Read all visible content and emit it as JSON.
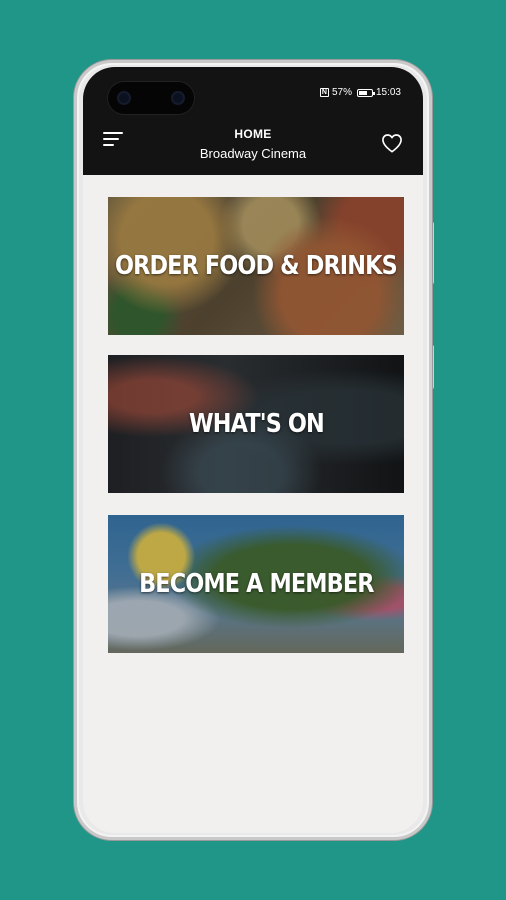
{
  "status_bar": {
    "battery": "57%",
    "time": "15:03",
    "icons": [
      "nfc-icon",
      "battery-icon"
    ]
  },
  "header": {
    "title": "HOME",
    "subtitle": "Broadway Cinema",
    "menu_icon": "menu-icon",
    "favorite_icon": "heart-icon"
  },
  "tiles": [
    {
      "label": "ORDER FOOD & DRINKS"
    },
    {
      "label": "WHAT'S ON"
    },
    {
      "label": "BECOME A MEMBER"
    }
  ],
  "colors": {
    "background": "#1f9688",
    "header_bar": "#131313",
    "screen": "#f1f0ef",
    "text": "#ffffff"
  }
}
